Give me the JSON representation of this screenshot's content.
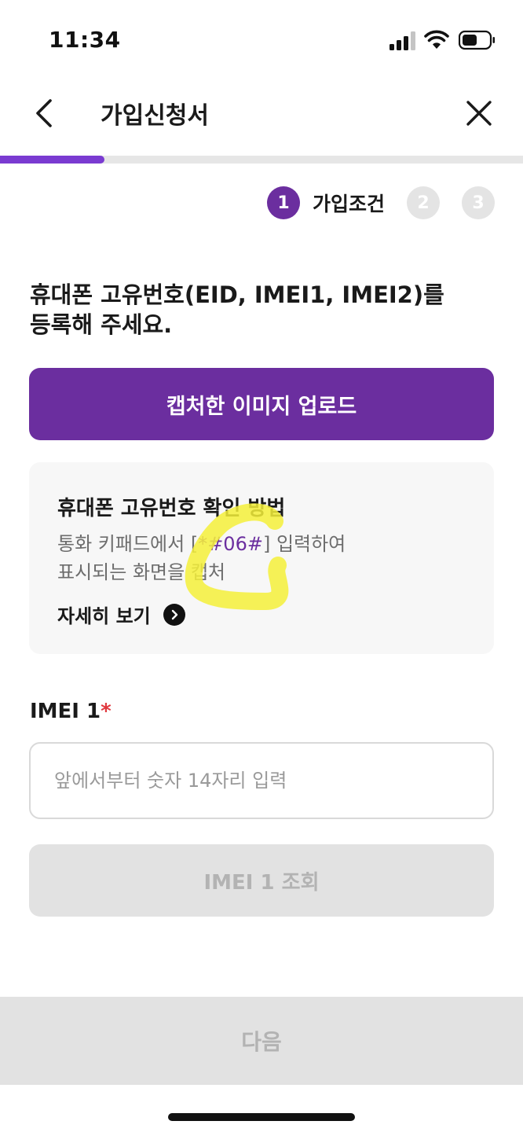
{
  "status_bar": {
    "time": "11:34",
    "icons": [
      "signal-icon",
      "wifi-icon",
      "battery-icon"
    ]
  },
  "header": {
    "title": "가입신청서",
    "back_icon": "chevron-left-icon",
    "close_icon": "close-icon"
  },
  "progress": {
    "fraction": 0.2
  },
  "steps": [
    {
      "number": "1",
      "label": "가입조건",
      "active": true
    },
    {
      "number": "2",
      "label": "",
      "active": false
    },
    {
      "number": "3",
      "label": "",
      "active": false
    }
  ],
  "instruction": {
    "line1": "휴대폰 고유번호(EID, IMEI1, IMEI2)를",
    "line2": "등록해 주세요."
  },
  "upload_button": {
    "label": "캡처한 이미지 업로드"
  },
  "info_card": {
    "title": "휴대폰 고유번호 확인 방법",
    "body_prefix": "통화 키패드에서 [",
    "code": "*#06#",
    "body_suffix": "] 입력하여",
    "body_line2": "표시되는 화면을 캡처",
    "detail_link": "자세히 보기"
  },
  "imei1": {
    "label": "IMEI 1",
    "required_mark": "*",
    "placeholder": "앞에서부터 숫자 14자리 입력",
    "value": "",
    "lookup_button": "IMEI 1 조회"
  },
  "footer": {
    "next_button": "다음"
  },
  "colors": {
    "brand_purple": "#6b2e9f",
    "progress_purple": "#7a3bd1",
    "required_red": "#e0383e",
    "disabled_gray": "#e2e2e2",
    "highlighter_yellow": "#f5f03a"
  }
}
